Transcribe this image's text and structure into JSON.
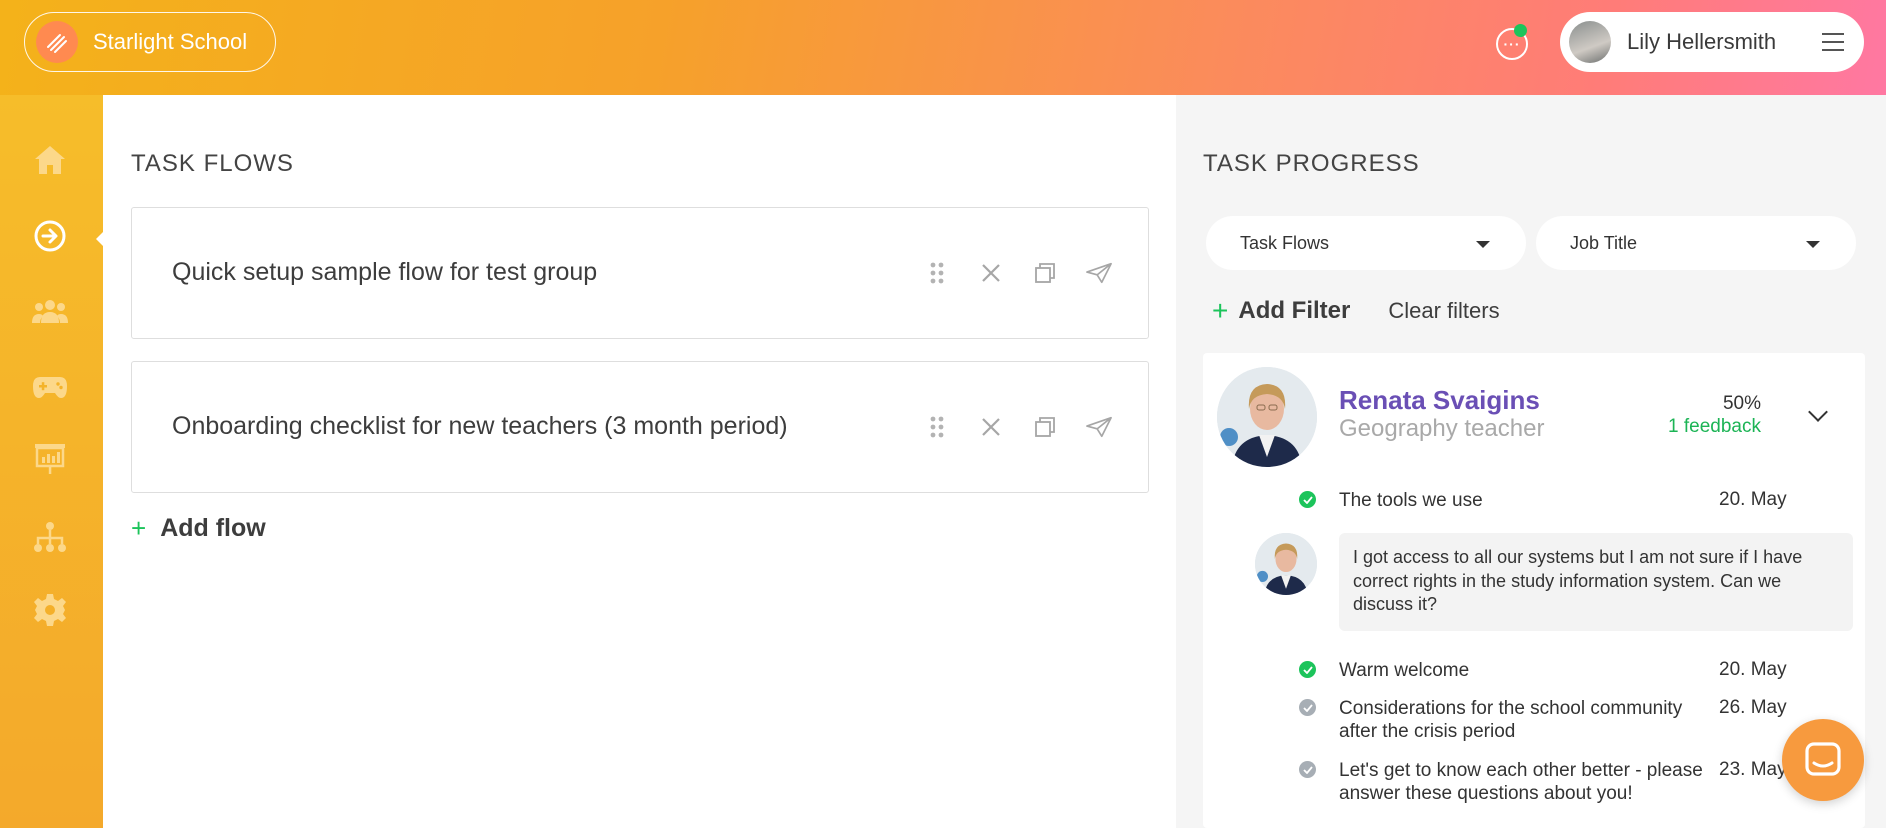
{
  "header": {
    "school_name": "Starlight School",
    "chat_icon_glyph": "···",
    "user_name": "Lily Hellersmith"
  },
  "sidebar": {
    "items": [
      {
        "icon": "home-icon"
      },
      {
        "icon": "arrow-right-circle-icon",
        "active": true
      },
      {
        "icon": "users-icon"
      },
      {
        "icon": "gamepad-icon"
      },
      {
        "icon": "presentation-icon"
      },
      {
        "icon": "org-chart-icon"
      },
      {
        "icon": "gear-icon"
      }
    ]
  },
  "task_flows": {
    "title": "TASK FLOWS",
    "flows": [
      {
        "title": "Quick setup sample flow for test group"
      },
      {
        "title": "Onboarding checklist for new teachers (3 month period)"
      }
    ],
    "add_flow_label": "Add flow"
  },
  "task_progress": {
    "title": "TASK PROGRESS",
    "dropdown_flows": "Task Flows",
    "dropdown_job": "Job Title",
    "add_filter_label": "Add Filter",
    "clear_filters_label": "Clear filters",
    "person": {
      "name": "Renata Svaigins",
      "role": "Geography teacher",
      "percent": "50%",
      "feedback": "1 feedback"
    },
    "tasks": [
      {
        "text": "The tools we use",
        "date": "20. May",
        "done": true
      },
      {
        "text": "Warm welcome",
        "date": "20. May",
        "done": true
      },
      {
        "text": "Considerations for the school community after the crisis period",
        "date": "26. May",
        "done": false
      },
      {
        "text": "Let's get to know each other better - please answer these questions about you!",
        "date": "23. May",
        "done": false
      }
    ],
    "comment": "I got access to all our systems but I am not sure if I have correct rights in the study information system. Can we discuss it?"
  },
  "colors": {
    "accent_green": "#1cc45b",
    "name_purple": "#6a4fb5",
    "sidebar_orange": "#f4a92b",
    "done_green": "#1cc45b",
    "pending_grey": "#a7aeb5"
  }
}
